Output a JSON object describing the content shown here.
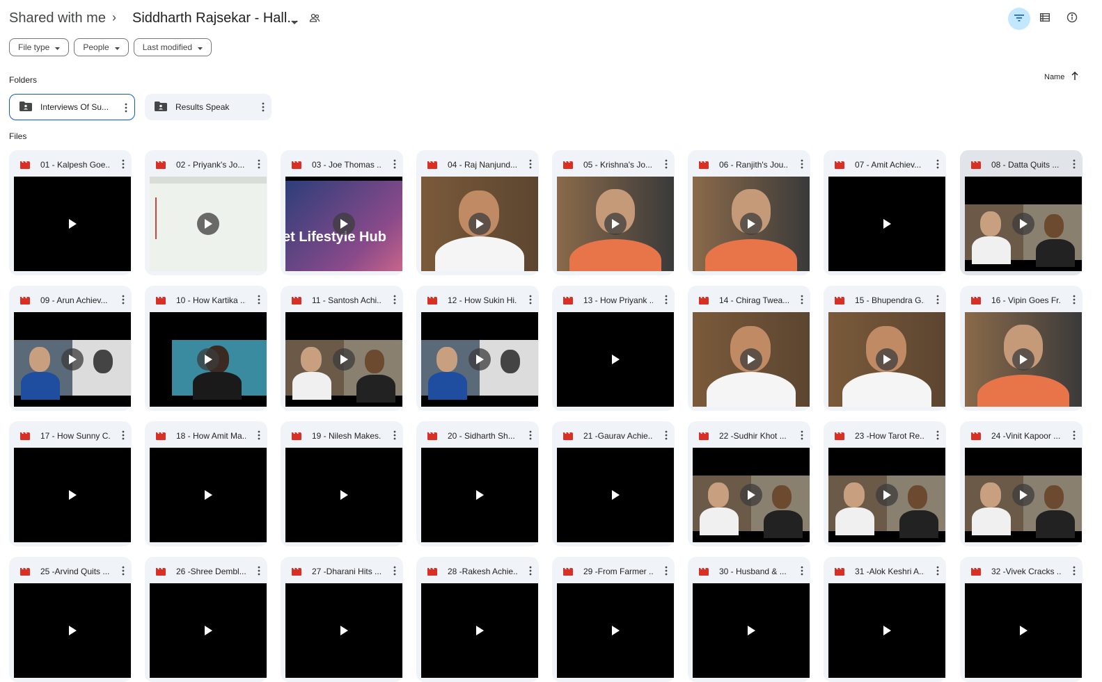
{
  "header": {
    "breadcrumb_root": "Shared with me",
    "breadcrumb_separator": "›",
    "current_folder": "Siddharth Rajsekar - Hall...",
    "icons": {
      "caret": "dropdown-caret-icon",
      "shared": "people-icon",
      "filter": "filter-icon",
      "view": "list-view-icon",
      "info": "info-icon"
    }
  },
  "filters": [
    {
      "label": "File type"
    },
    {
      "label": "People"
    },
    {
      "label": "Last modified"
    }
  ],
  "sort": {
    "label": "Name",
    "direction_icon": "arrow-up-icon"
  },
  "sections": {
    "folders": "Folders",
    "files": "Files"
  },
  "folders": [
    {
      "name": "Interviews Of Su...",
      "selected": true
    },
    {
      "name": "Results Speak",
      "selected": false
    }
  ],
  "files": [
    {
      "name": "01 - Kalpesh Goe...",
      "thumb": "black"
    },
    {
      "name": "02 - Priyank's Jo...",
      "thumb": "screen"
    },
    {
      "name": "03 - Joe Thomas ...",
      "thumb": "banner",
      "banner_text": "et Lifestyle Hub"
    },
    {
      "name": "04 - Raj Nanjund...",
      "thumb": "person-white"
    },
    {
      "name": "05 - Krishna's Jo...",
      "thumb": "person-orange"
    },
    {
      "name": "06 - Ranjith's Jou...",
      "thumb": "person-orange"
    },
    {
      "name": "07 - Amit Achiev...",
      "thumb": "black"
    },
    {
      "name": "08 - Datta Quits ...",
      "thumb": "split",
      "hover": true
    },
    {
      "name": "09 - Arun Achiev...",
      "thumb": "split-blue"
    },
    {
      "name": "10 - How Kartika ...",
      "thumb": "split-single"
    },
    {
      "name": "11 - Santosh Achi...",
      "thumb": "split"
    },
    {
      "name": "12 - How Sukin Hi...",
      "thumb": "split-blue"
    },
    {
      "name": "13 - How Priyank ...",
      "thumb": "black"
    },
    {
      "name": "14 - Chirag Twea...",
      "thumb": "person-white"
    },
    {
      "name": "15 - Bhupendra G...",
      "thumb": "person-white"
    },
    {
      "name": "16 - Vipin Goes Fr...",
      "thumb": "person-orange"
    },
    {
      "name": "17 - How Sunny C...",
      "thumb": "black"
    },
    {
      "name": "18 - How Amit Ma...",
      "thumb": "black"
    },
    {
      "name": "19 - Nilesh Makes...",
      "thumb": "black"
    },
    {
      "name": "20 - Sidharth Sh...",
      "thumb": "black"
    },
    {
      "name": "21 -Gaurav Achie...",
      "thumb": "black"
    },
    {
      "name": "22 -Sudhir Khot ...",
      "thumb": "split"
    },
    {
      "name": "23 -How Tarot Re...",
      "thumb": "split"
    },
    {
      "name": "24 -Vinit Kapoor ...",
      "thumb": "split"
    },
    {
      "name": "25 -Arvind Quits ...",
      "thumb": "black"
    },
    {
      "name": "26 -Shree Dembl...",
      "thumb": "black"
    },
    {
      "name": "27 -Dharani Hits ...",
      "thumb": "black"
    },
    {
      "name": "28 -Rakesh Achie...",
      "thumb": "black"
    },
    {
      "name": "29 -From Farmer ...",
      "thumb": "black"
    },
    {
      "name": "30 - Husband & ...",
      "thumb": "black"
    },
    {
      "name": "31 -Alok Keshri A...",
      "thumb": "black"
    },
    {
      "name": "32 -Vivek Cracks ...",
      "thumb": "black"
    }
  ],
  "colors": {
    "accent": "#0b57d0",
    "video_icon": "#d93025",
    "card_bg": "#f0f4f9",
    "active_btn": "#c2e7ff"
  }
}
